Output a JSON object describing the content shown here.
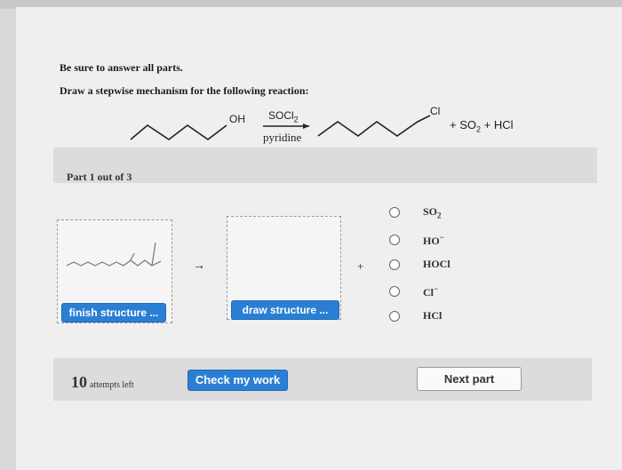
{
  "instructions": {
    "line1": "Be sure to answer all parts.",
    "line2": "Draw a stepwise mechanism for the following reaction:"
  },
  "reaction": {
    "reactant_group": "OH",
    "reagent": "SOCl",
    "reagent_sub": "2",
    "solvent": "pyridine",
    "product_group": "Cl",
    "byproducts_prefix": "+ SO",
    "byproducts_sub": "2",
    "byproducts_suffix": "+ HCl"
  },
  "part": {
    "label": "Part 1 out of 3"
  },
  "drawing": {
    "finish_button": "finish structure ...",
    "draw_button": "draw structure ...",
    "arrow": "→",
    "plus": "+"
  },
  "options": [
    {
      "main": "SO",
      "sub": "2",
      "sup": ""
    },
    {
      "main": "HO",
      "sub": "",
      "sup": "−"
    },
    {
      "main": "HOCl",
      "sub": "",
      "sup": ""
    },
    {
      "main": "Cl",
      "sub": "",
      "sup": "−"
    },
    {
      "main": "HCl",
      "sub": "",
      "sup": ""
    }
  ],
  "footer": {
    "attempts_count": "10",
    "attempts_text": "attempts left",
    "check_button": "Check my work",
    "next_button": "Next part"
  }
}
